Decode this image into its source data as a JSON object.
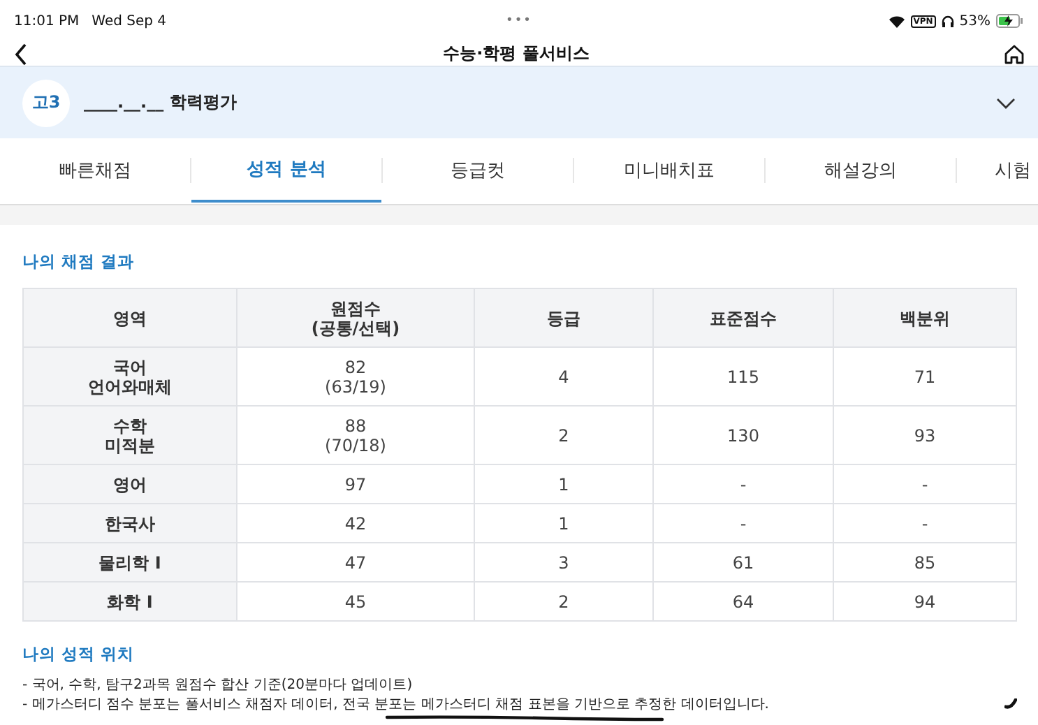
{
  "status_bar": {
    "time": "11:01 PM",
    "date": "Wed Sep 4",
    "handle": "•••",
    "vpn": "VPN",
    "battery": "53%"
  },
  "nav": {
    "title": "수능·학평 풀서비스"
  },
  "exam": {
    "grade": "고3",
    "title": "____.__.__ 학력평가"
  },
  "tabs": [
    {
      "label": "빠른채점",
      "selected": false
    },
    {
      "label": "성적 분석",
      "selected": true
    },
    {
      "label": "등급컷",
      "selected": false
    },
    {
      "label": "미니배치표",
      "selected": false
    },
    {
      "label": "해설강의",
      "selected": false
    },
    {
      "label": "시험",
      "selected": false
    }
  ],
  "result": {
    "title": "나의 채점 결과",
    "columns": [
      "영역",
      "원점수\n(공통/선택)",
      "등급",
      "표준점수",
      "백분위"
    ],
    "rows": [
      [
        "국어\n언어와매체",
        "82\n(63/19)",
        "4",
        "115",
        "71"
      ],
      [
        "수학\n미적분",
        "88\n(70/18)",
        "2",
        "130",
        "93"
      ],
      [
        "영어",
        "97",
        "1",
        "-",
        "-"
      ],
      [
        "한국사",
        "42",
        "1",
        "-",
        "-"
      ],
      [
        "물리학 I",
        "47",
        "3",
        "61",
        "85"
      ],
      [
        "화학 I",
        "45",
        "2",
        "64",
        "94"
      ]
    ]
  },
  "position": {
    "title": "나의 성적 위치",
    "notes": [
      "- 국어, 수학, 탐구2과목 원점수 합산 기준(20분마다 업데이트)",
      "- 메가스터디 점수 분포는 풀서비스 채점자 데이터, 전국 분포는 메가스터디 채점 표본을 기반으로 추정한 데이터입니다."
    ]
  }
}
